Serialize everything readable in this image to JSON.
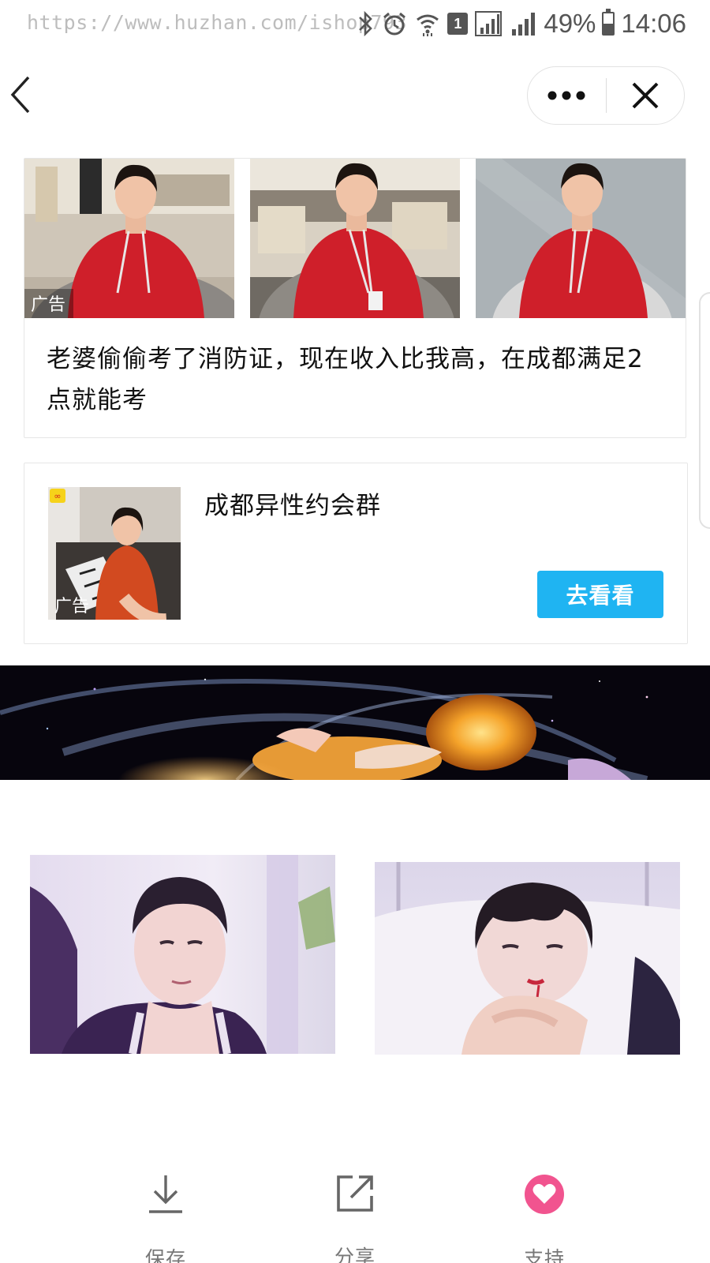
{
  "status_bar": {
    "watermark": "https://www.huzhan.com/ishop793",
    "sim_slot": "1",
    "battery": "49%",
    "battery_level": 0.49,
    "time": "14:06"
  },
  "nav": {
    "back_icon": "chevron-left-icon",
    "more_icon": "more-dots-icon",
    "close_icon": "close-icon"
  },
  "ad_card_1": {
    "ad_label": "广告",
    "title": "老婆偷偷考了消防证，现在收入比我高，在成都满足2点就能考"
  },
  "ad_card_2": {
    "ad_label": "广告",
    "title": "成都异性约会群",
    "button_label": "去看看",
    "button_color": "#1fb4f2"
  },
  "actions": [
    {
      "label": "保存",
      "icon": "download-icon"
    },
    {
      "label": "分享",
      "icon": "share-icon"
    },
    {
      "label": "支持",
      "icon": "heart-icon",
      "color": "#f1548f"
    }
  ]
}
